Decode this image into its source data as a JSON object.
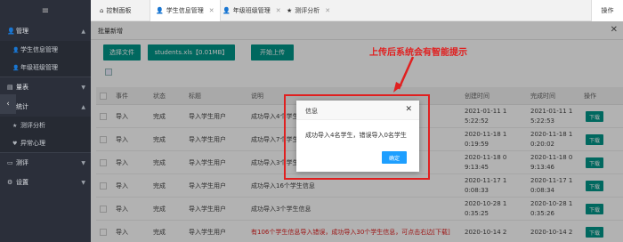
{
  "sidebar": {
    "menu_icon": "≡",
    "items": [
      {
        "label": "管理",
        "icon": "user-icon"
      },
      {
        "label": "学生信息管理",
        "icon": "user-icon"
      },
      {
        "label": "年级班级管理",
        "icon": "user-icon"
      },
      {
        "label": "量表",
        "icon": "stack-icon"
      },
      {
        "label": "统计",
        "icon": "chart-icon"
      },
      {
        "label": "测评分析",
        "icon": "star-icon"
      },
      {
        "label": "异常心理",
        "icon": "heart-icon"
      },
      {
        "label": "测评",
        "icon": "monitor-icon"
      },
      {
        "label": "设置",
        "icon": "gear-icon"
      }
    ]
  },
  "tabs": [
    {
      "label": "控制面板",
      "icon": "home-icon"
    },
    {
      "label": "学生信息管理",
      "icon": "user-icon"
    },
    {
      "label": "年级班级管理",
      "icon": "user-icon"
    },
    {
      "label": "测评分析",
      "icon": "star-icon"
    }
  ],
  "tab_ops_label": "操作",
  "main": {
    "title": "批量新增",
    "choose_file": "选择文件",
    "file_name": "students.xls【0.01MB】",
    "start_upload": "开始上传"
  },
  "annotation": "上传后系统会有智能提示",
  "table": {
    "headers": [
      "事件",
      "状态",
      "标题",
      "说明",
      "创建时间",
      "完成时间",
      "操作"
    ],
    "rows": [
      {
        "event": "导入",
        "status": "完成",
        "title": "导入学生用户",
        "desc": "成功导入4个学生信息",
        "created_date": "2021-01-11 1",
        "created_time": "5:22:52",
        "done_date": "2021-01-11 1",
        "done_time": "5:22:53",
        "action": "下载"
      },
      {
        "event": "导入",
        "status": "完成",
        "title": "导入学生用户",
        "desc": "成功导入7个学生信息",
        "created_date": "2020-11-18 1",
        "created_time": "0:19:59",
        "done_date": "2020-11-18 1",
        "done_time": "0:20:02",
        "action": "下载"
      },
      {
        "event": "导入",
        "status": "完成",
        "title": "导入学生用户",
        "desc": "成功导入3个学生信息",
        "created_date": "2020-11-18 0",
        "created_time": "9:13:45",
        "done_date": "2020-11-18 0",
        "done_time": "9:13:46",
        "action": "下载"
      },
      {
        "event": "导入",
        "status": "完成",
        "title": "导入学生用户",
        "desc": "成功导入16个学生信息",
        "created_date": "2020-11-17 1",
        "created_time": "0:08:33",
        "done_date": "2020-11-17 1",
        "done_time": "0:08:34",
        "action": "下载"
      },
      {
        "event": "导入",
        "status": "完成",
        "title": "导入学生用户",
        "desc": "成功导入3个学生信息",
        "created_date": "2020-10-28 1",
        "created_time": "0:35:25",
        "done_date": "2020-10-28 1",
        "done_time": "0:35:26",
        "action": "下载"
      },
      {
        "event": "导入",
        "status": "完成",
        "title": "导入学生用户",
        "desc": "有106个学生信息导入错误，成功导入30个学生信息，可点击右边[下载]",
        "created_date": "2020-10-14 2",
        "created_time": "",
        "done_date": "2020-10-14 2",
        "done_time": "",
        "action": "下载"
      }
    ]
  },
  "dialog": {
    "title": "信息",
    "message": "成功导入4名学生，错误导入0名学生",
    "ok": "确定",
    "close": "✕"
  },
  "colors": {
    "accent": "#009688",
    "dialog_button": "#1e9fff",
    "highlight": "#e02020",
    "sidebar": "#2b2f3a"
  }
}
